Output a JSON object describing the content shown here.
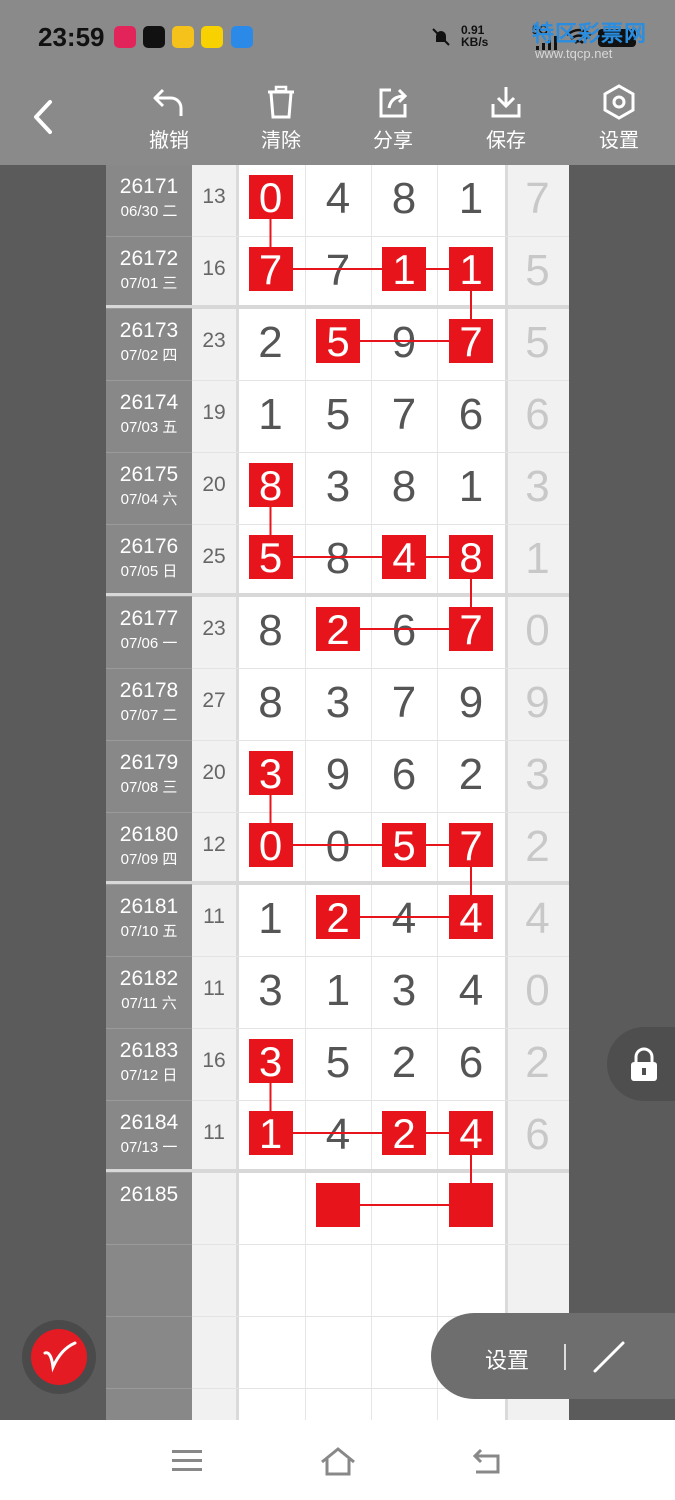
{
  "status_bar": {
    "time": "23:59",
    "speed_value": "0.91",
    "speed_unit": "KB/s",
    "network": "5G",
    "watermark_title": "特区彩票网",
    "watermark_url": "www.tqcp.net"
  },
  "toolbar": {
    "undo_label": "撤销",
    "clear_label": "清除",
    "share_label": "分享",
    "save_label": "保存",
    "settings_label": "设置"
  },
  "rows": [
    {
      "period": "26171",
      "date": "06/30 二",
      "sum": "13",
      "digits": [
        "0",
        "4",
        "8",
        "1"
      ],
      "extra": "7"
    },
    {
      "period": "26172",
      "date": "07/01 三",
      "sum": "16",
      "digits": [
        "7",
        "7",
        "1",
        "1"
      ],
      "extra": "5"
    },
    {
      "period": "26173",
      "date": "07/02 四",
      "sum": "23",
      "digits": [
        "2",
        "5",
        "9",
        "7"
      ],
      "extra": "5"
    },
    {
      "period": "26174",
      "date": "07/03 五",
      "sum": "19",
      "digits": [
        "1",
        "5",
        "7",
        "6"
      ],
      "extra": "6"
    },
    {
      "period": "26175",
      "date": "07/04 六",
      "sum": "20",
      "digits": [
        "8",
        "3",
        "8",
        "1"
      ],
      "extra": "3"
    },
    {
      "period": "26176",
      "date": "07/05 日",
      "sum": "25",
      "digits": [
        "5",
        "8",
        "4",
        "8"
      ],
      "extra": "1"
    },
    {
      "period": "26177",
      "date": "07/06 一",
      "sum": "23",
      "digits": [
        "8",
        "2",
        "6",
        "7"
      ],
      "extra": "0"
    },
    {
      "period": "26178",
      "date": "07/07 二",
      "sum": "27",
      "digits": [
        "8",
        "3",
        "7",
        "9"
      ],
      "extra": "9"
    },
    {
      "period": "26179",
      "date": "07/08 三",
      "sum": "20",
      "digits": [
        "3",
        "9",
        "6",
        "2"
      ],
      "extra": "3"
    },
    {
      "period": "26180",
      "date": "07/09 四",
      "sum": "12",
      "digits": [
        "0",
        "0",
        "5",
        "7"
      ],
      "extra": "2"
    },
    {
      "period": "26181",
      "date": "07/10 五",
      "sum": "11",
      "digits": [
        "1",
        "2",
        "4",
        "4"
      ],
      "extra": "4"
    },
    {
      "period": "26182",
      "date": "07/11 六",
      "sum": "11",
      "digits": [
        "3",
        "1",
        "3",
        "4"
      ],
      "extra": "0"
    },
    {
      "period": "26183",
      "date": "07/12 日",
      "sum": "16",
      "digits": [
        "3",
        "5",
        "2",
        "6"
      ],
      "extra": "2"
    },
    {
      "period": "26184",
      "date": "07/13 一",
      "sum": "11",
      "digits": [
        "1",
        "4",
        "2",
        "4"
      ],
      "extra": "6"
    },
    {
      "period": "26185",
      "date": "",
      "sum": "",
      "digits": [
        "",
        "",
        "",
        ""
      ],
      "extra": ""
    },
    {
      "period": "",
      "date": "",
      "sum": "",
      "digits": [
        "",
        "",
        "",
        ""
      ],
      "extra": ""
    },
    {
      "period": "",
      "date": "",
      "sum": "",
      "digits": [
        "",
        "",
        "",
        ""
      ],
      "extra": ""
    },
    {
      "period": "",
      "date": "",
      "sum": "",
      "digits": [
        "",
        "",
        "",
        ""
      ],
      "extra": ""
    }
  ],
  "highlights": [
    [
      0,
      0
    ],
    [
      1,
      0
    ],
    [
      1,
      2
    ],
    [
      1,
      3
    ],
    [
      2,
      1
    ],
    [
      2,
      3
    ],
    [
      4,
      0
    ],
    [
      5,
      0
    ],
    [
      5,
      2
    ],
    [
      5,
      3
    ],
    [
      6,
      1
    ],
    [
      6,
      3
    ],
    [
      8,
      0
    ],
    [
      9,
      0
    ],
    [
      9,
      2
    ],
    [
      9,
      3
    ],
    [
      10,
      1
    ],
    [
      10,
      3
    ],
    [
      12,
      0
    ],
    [
      13,
      0
    ],
    [
      13,
      2
    ],
    [
      13,
      3
    ],
    [
      14,
      1
    ],
    [
      14,
      3
    ]
  ],
  "links": [
    [
      [
        0,
        0
      ],
      [
        1,
        0
      ]
    ],
    [
      [
        1,
        0
      ],
      [
        1,
        2
      ]
    ],
    [
      [
        1,
        2
      ],
      [
        1,
        3
      ]
    ],
    [
      [
        1,
        3
      ],
      [
        2,
        3
      ]
    ],
    [
      [
        2,
        3
      ],
      [
        2,
        1
      ]
    ],
    [
      [
        4,
        0
      ],
      [
        5,
        0
      ]
    ],
    [
      [
        5,
        0
      ],
      [
        5,
        2
      ]
    ],
    [
      [
        5,
        2
      ],
      [
        5,
        3
      ]
    ],
    [
      [
        5,
        3
      ],
      [
        6,
        3
      ]
    ],
    [
      [
        6,
        3
      ],
      [
        6,
        1
      ]
    ],
    [
      [
        8,
        0
      ],
      [
        9,
        0
      ]
    ],
    [
      [
        9,
        0
      ],
      [
        9,
        2
      ]
    ],
    [
      [
        9,
        2
      ],
      [
        9,
        3
      ]
    ],
    [
      [
        9,
        3
      ],
      [
        10,
        3
      ]
    ],
    [
      [
        10,
        3
      ],
      [
        10,
        1
      ]
    ],
    [
      [
        12,
        0
      ],
      [
        13,
        0
      ]
    ],
    [
      [
        13,
        0
      ],
      [
        13,
        2
      ]
    ],
    [
      [
        13,
        2
      ],
      [
        13,
        3
      ]
    ],
    [
      [
        13,
        3
      ],
      [
        14,
        3
      ]
    ],
    [
      [
        14,
        3
      ],
      [
        14,
        1
      ]
    ]
  ],
  "separator_after_rows": [
    1,
    5,
    9,
    13
  ],
  "panel": {
    "settings_label": "设置"
  },
  "colors": {
    "accent": "#e8141c",
    "header_bg": "#8a8a8a",
    "side_bg": "#888888"
  }
}
